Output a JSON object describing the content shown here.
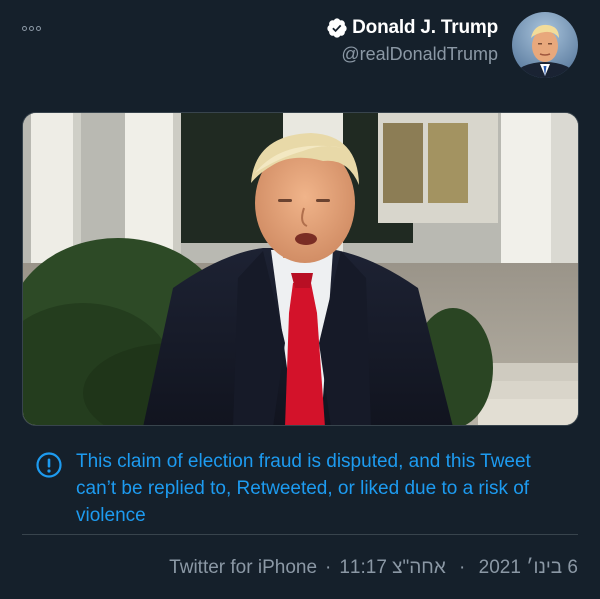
{
  "tweet": {
    "author": {
      "name": "Donald J. Trump",
      "handle": "@realDonaldTrump",
      "verified": true
    },
    "menu_icon": "more-horizontal-icon",
    "media": {
      "type": "video-still"
    },
    "warning": {
      "icon": "alert-circle-icon",
      "text": "This claim of election fraud is disputed, and this Tweet can’t be replied to, Retweeted, or liked due to a risk of violence"
    },
    "meta": {
      "time": "11:17",
      "time_suffix": "אחה\"צ",
      "date": "6 בינו׳ 2021",
      "separator": "·",
      "source": "Twitter for iPhone"
    }
  },
  "colors": {
    "background": "#15202b",
    "text_primary": "#ffffff",
    "text_secondary": "#8b98a5",
    "accent": "#1d9bf0",
    "border": "#38444d"
  }
}
